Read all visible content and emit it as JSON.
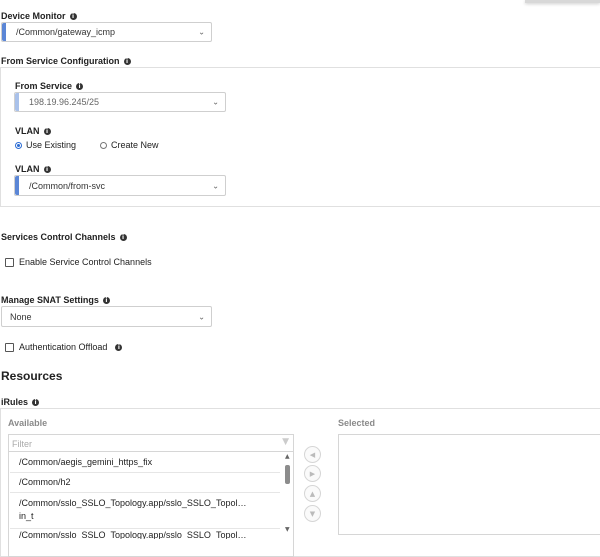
{
  "device_monitor": {
    "label": "Device Monitor",
    "value": "/Common/gateway_icmp"
  },
  "from_service_config": {
    "title": "From Service Configuration",
    "from_service": {
      "label": "From Service",
      "value": "198.19.96.245/25"
    },
    "vlan_mode": {
      "label": "VLAN",
      "options": [
        "Use Existing",
        "Create New"
      ],
      "selected": "Use Existing"
    },
    "vlan_select": {
      "label": "VLAN",
      "value": "/Common/from-svc"
    }
  },
  "service_control": {
    "label": "Services Control Channels",
    "checkbox_label": "Enable Service Control Channels",
    "checked": false
  },
  "snat": {
    "label": "Manage SNAT Settings",
    "value": "None"
  },
  "auth_offload": {
    "label": "Authentication Offload",
    "checked": false
  },
  "resources": {
    "title": "Resources"
  },
  "irules": {
    "label": "iRules",
    "available_label": "Available",
    "selected_label": "Selected",
    "filter_placeholder": "Filter",
    "items": [
      "/Common/aegis_gemini_https_fix",
      "/Common/h2",
      "/Common/sslo_SSLO_Topology.app/sslo_SSLO_Topol…",
      "in_t",
      "/Common/sslo_SSLO_Topology.app/sslo_SSLO_Topol…"
    ]
  },
  "colors": {
    "accent_blue": "#5b86d6",
    "accent_light": "#a9c1ea"
  },
  "icons": [
    "info-icon",
    "chevron-down-icon",
    "filter-icon",
    "arrow-left-icon",
    "arrow-right-icon",
    "arrow-up-icon",
    "arrow-down-icon"
  ]
}
